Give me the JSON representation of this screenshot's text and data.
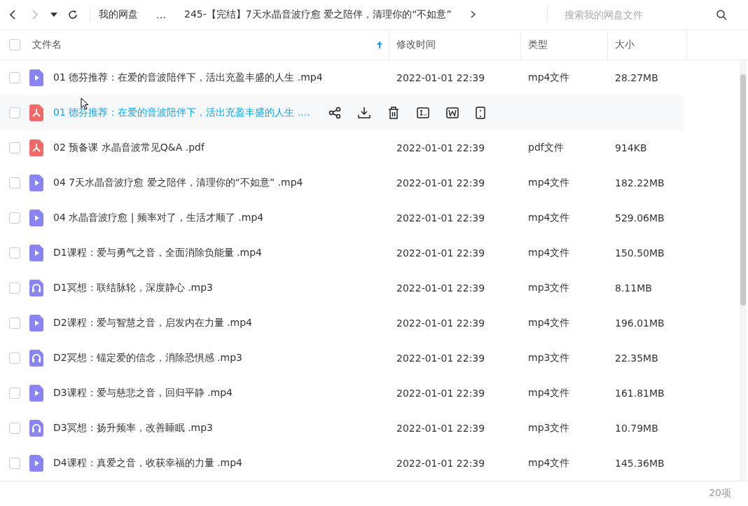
{
  "breadcrumb": {
    "items": [
      "我的网盘",
      "…",
      "245-【完结】7天水晶音波疗愈  爱之陪伴，清理你的“不如意”"
    ]
  },
  "search": {
    "placeholder": "搜索我的网盘文件"
  },
  "select_all": {
    "checked": false
  },
  "columns": [
    {
      "label": "文件名",
      "sorted": true
    },
    {
      "label": "修改时间",
      "sorted": false
    },
    {
      "label": "类型",
      "sorted": false
    },
    {
      "label": "大小",
      "sorted": false
    }
  ],
  "rows": [
    {
      "kind": "video",
      "checked": false,
      "name": "01 德芬推荐：在爱的音波陪伴下，活出充盈丰盛的人生 .mp4",
      "time": "2022-01-01 22:39",
      "type": "mp4文件",
      "size": "28.27MB",
      "hovered": false
    },
    {
      "kind": "pdf",
      "checked": false,
      "name": "01 德芬推荐：在爱的音波陪伴下，活出充盈丰盛的人生 ....",
      "hovered": true
    },
    {
      "kind": "pdf",
      "checked": false,
      "name": "02 预备课  水晶音波常见Q&A .pdf",
      "time": "2022-01-01 22:39",
      "type": "pdf文件",
      "size": "914KB",
      "hovered": false
    },
    {
      "kind": "video",
      "checked": false,
      "name": "04 7天水晶音波疗愈  爱之陪伴，清理你的“不如意” .mp4",
      "time": "2022-01-01 22:39",
      "type": "mp4文件",
      "size": "182.22MB",
      "hovered": false
    },
    {
      "kind": "video",
      "checked": false,
      "name": "04 水晶音波疗愈 | 频率对了，生活才顺了 .mp4",
      "time": "2022-01-01 22:39",
      "type": "mp4文件",
      "size": "529.06MB",
      "hovered": false
    },
    {
      "kind": "video",
      "checked": false,
      "name": "D1课程：爱与勇气之音，全面消除负能量 .mp4",
      "time": "2022-01-01 22:39",
      "type": "mp4文件",
      "size": "150.50MB",
      "hovered": false
    },
    {
      "kind": "audio",
      "checked": false,
      "name": "D1冥想：联结脉轮，深度静心 .mp3",
      "time": "2022-01-01 22:39",
      "type": "mp3文件",
      "size": "8.11MB",
      "hovered": false
    },
    {
      "kind": "video",
      "checked": false,
      "name": "D2课程：爱与智慧之音，启发内在力量 .mp4",
      "time": "2022-01-01 22:39",
      "type": "mp4文件",
      "size": "196.01MB",
      "hovered": false
    },
    {
      "kind": "audio",
      "checked": false,
      "name": "D2冥想：锚定爱的信念，消除恐惧感 .mp3",
      "time": "2022-01-01 22:39",
      "type": "mp3文件",
      "size": "22.35MB",
      "hovered": false
    },
    {
      "kind": "video",
      "checked": false,
      "name": "D3课程：爱与慈悲之音，回归平静 .mp4",
      "time": "2022-01-01 22:39",
      "type": "mp4文件",
      "size": "161.81MB",
      "hovered": false
    },
    {
      "kind": "audio",
      "checked": false,
      "name": "D3冥想：扬升频率，改善睡眠 .mp3",
      "time": "2022-01-01 22:39",
      "type": "mp3文件",
      "size": "10.79MB",
      "hovered": false
    },
    {
      "kind": "video",
      "checked": false,
      "name": "D4课程：真爱之音，收获幸福的力量 .mp4",
      "time": "2022-01-01 22:39",
      "type": "mp4文件",
      "size": "145.36MB",
      "hovered": false
    }
  ],
  "status_bar": {
    "count": "20项"
  }
}
